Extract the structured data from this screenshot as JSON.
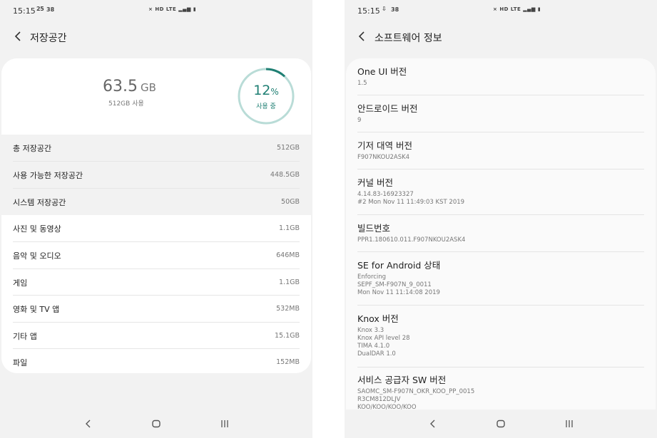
{
  "left_screen": {
    "status_bar": {
      "time": "15:15",
      "notification_top": "25",
      "notification_side": "38",
      "system_icons": "HD LTE"
    },
    "app_bar": {
      "title": "저장공간",
      "back_icon": "chevron-left-icon"
    },
    "summary": {
      "used_value": "63.5",
      "used_unit": "GB",
      "capacity": "512GB 사용",
      "percent_value": "12",
      "percent_sign": "%",
      "percent_label": "사용 중",
      "percent_fraction": 0.12,
      "ring_color": "#1f7f73",
      "ring_track_color": "#b9dcd7"
    },
    "system_rows": [
      {
        "label": "총 저장공간",
        "value": "512GB"
      },
      {
        "label": "사용 가능한 저장공간",
        "value": "448.5GB"
      },
      {
        "label": "시스템 저장공간",
        "value": "50GB"
      }
    ],
    "category_rows": [
      {
        "label": "사진 및 동영상",
        "value": "1.1GB"
      },
      {
        "label": "음악 및 오디오",
        "value": "646MB"
      },
      {
        "label": "게임",
        "value": "1.1GB"
      },
      {
        "label": "영화 및 TV 앱",
        "value": "532MB"
      },
      {
        "label": "기타 앱",
        "value": "15.1GB"
      },
      {
        "label": "파일",
        "value": "152MB"
      }
    ]
  },
  "right_screen": {
    "status_bar": {
      "time": "15:15",
      "notification_side": "38",
      "system_icons": "HD LTE"
    },
    "app_bar": {
      "title": "소프트웨어 정보",
      "back_icon": "chevron-left-icon"
    },
    "items": [
      {
        "title": "One UI 버전",
        "lines": [
          "1.5"
        ]
      },
      {
        "title": "안드로이드 버전",
        "lines": [
          "9"
        ]
      },
      {
        "title": "기저 대역 버전",
        "lines": [
          "F907NKOU2ASK4"
        ]
      },
      {
        "title": "커널 버전",
        "lines": [
          "4.14.83-16923327",
          "#2 Mon Nov 11 11:49:03 KST 2019"
        ]
      },
      {
        "title": "빌드번호",
        "lines": [
          "PPR1.180610.011.F907NKOU2ASK4"
        ]
      },
      {
        "title": "SE for Android 상태",
        "lines": [
          "Enforcing",
          "SEPF_SM-F907N_9_0011",
          "Mon Nov 11 11:14:08 2019"
        ]
      },
      {
        "title": "Knox 버전",
        "lines": [
          "Knox 3.3",
          "Knox API level 28",
          "TIMA 4.1.0",
          "DualDAR 1.0"
        ]
      },
      {
        "title": "서비스 공급자 SW 버전",
        "lines": [
          "SAOMC_SM-F907N_OKR_KOO_PP_0015",
          "R3CM812DLJV",
          "KOO/KOO/KOO/KOO"
        ]
      }
    ]
  },
  "nav_bar": {
    "back_icon": "back-chevron-icon",
    "home_icon": "home-rounded-square-icon",
    "recents_icon": "recents-bars-icon"
  }
}
